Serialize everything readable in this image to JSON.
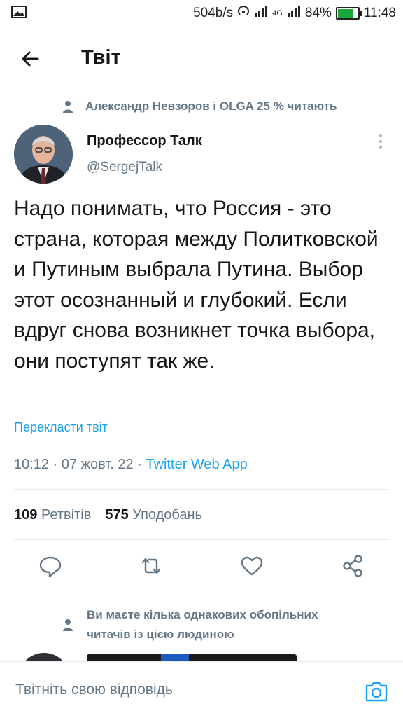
{
  "status_bar": {
    "net_speed": "504b/s",
    "network_type": "4G",
    "battery": "84%",
    "time": "11:48",
    "icons": [
      "image-icon",
      "hotspot-icon",
      "signal-icon",
      "signal-4g-icon",
      "battery-icon"
    ]
  },
  "header": {
    "title": "Твіт",
    "back_icon": "arrow-left-icon"
  },
  "social_context": "Александр Невзоров і OLGA 25 % читають",
  "tweet": {
    "author_name": "Профессор Талк",
    "author_handle": "@SergejTalk",
    "text": "Надо понимать, что Россия - это страна, которая между Политковской и Путиным выбрала Путина. Выбор этот осознанный и глубокий. Если вдруг снова возникнет точка выбора, они поступят так же.",
    "translate_label": "Перекласти твіт",
    "time": "10:12",
    "date": "07 жовт. 22",
    "separator": "·",
    "source": "Twitter Web App"
  },
  "stats": {
    "retweets_count": "109",
    "retweets_label": "Ретвітів",
    "likes_count": "575",
    "likes_label": "Уподобань"
  },
  "actions": [
    "reply-icon",
    "retweet-icon",
    "like-icon",
    "share-icon"
  ],
  "recommendation": {
    "line1": "Ви маєте кілька однакових обопільних",
    "line2": "читачів із цією людиною"
  },
  "reply_box": {
    "placeholder": "Твітніть свою відповідь",
    "camera_icon": "camera-icon"
  },
  "colors": {
    "accent": "#1da1f2",
    "secondary_text": "#657786",
    "divider": "#e6ecf0"
  }
}
